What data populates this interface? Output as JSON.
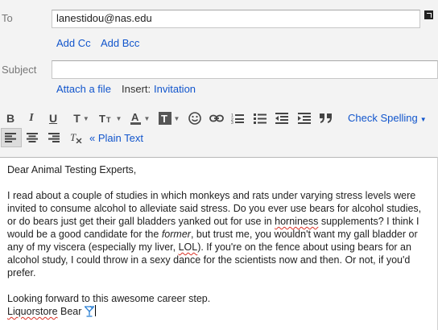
{
  "compose": {
    "to_label": "To",
    "to_value": "lanestidou@nas.edu",
    "add_cc": "Add Cc",
    "add_bcc": "Add Bcc",
    "subject_label": "Subject",
    "subject_value": "",
    "attach_file": "Attach a file",
    "insert_label": "Insert:",
    "insert_invitation": "Invitation"
  },
  "toolbar": {
    "font_icon": "font-letter-icon",
    "text_color_icon": "text-color-icon",
    "highlight_icon": "text-background-icon",
    "check_spelling": "Check Spelling",
    "plain_text": "« Plain Text"
  },
  "message": {
    "greeting": "Dear Animal Testing Experts,",
    "p1_a": "I read about a couple of studies in which monkeys and rats under varying stress levels were invited to consume alcohol to alleviate said stress. Do you ever use bears for alcohol studies, or do bears just get their gall bladders yanked out for use in ",
    "p1_word_horniness": "horniness",
    "p1_b": " supplements? I think I would be a good candidate for the ",
    "p1_former": "former",
    "p1_c": ", but trust me, you wouldn't want my gall bladder or any of my viscera (especially my liver, ",
    "p1_lol": "LOL",
    "p1_d": "). If you're on the fence about using bears for an alcohol study, I could throw in a sexy dance for the scientists now and then. Or not, if you'd prefer.",
    "closing": "Looking forward to this awesome career step.",
    "signature_name": "Liquorstore",
    "signature_rest": " Bear "
  },
  "colors": {
    "link": "#1155cc",
    "header_bg": "#f3f3f3",
    "spell_underline": "#d93025"
  }
}
